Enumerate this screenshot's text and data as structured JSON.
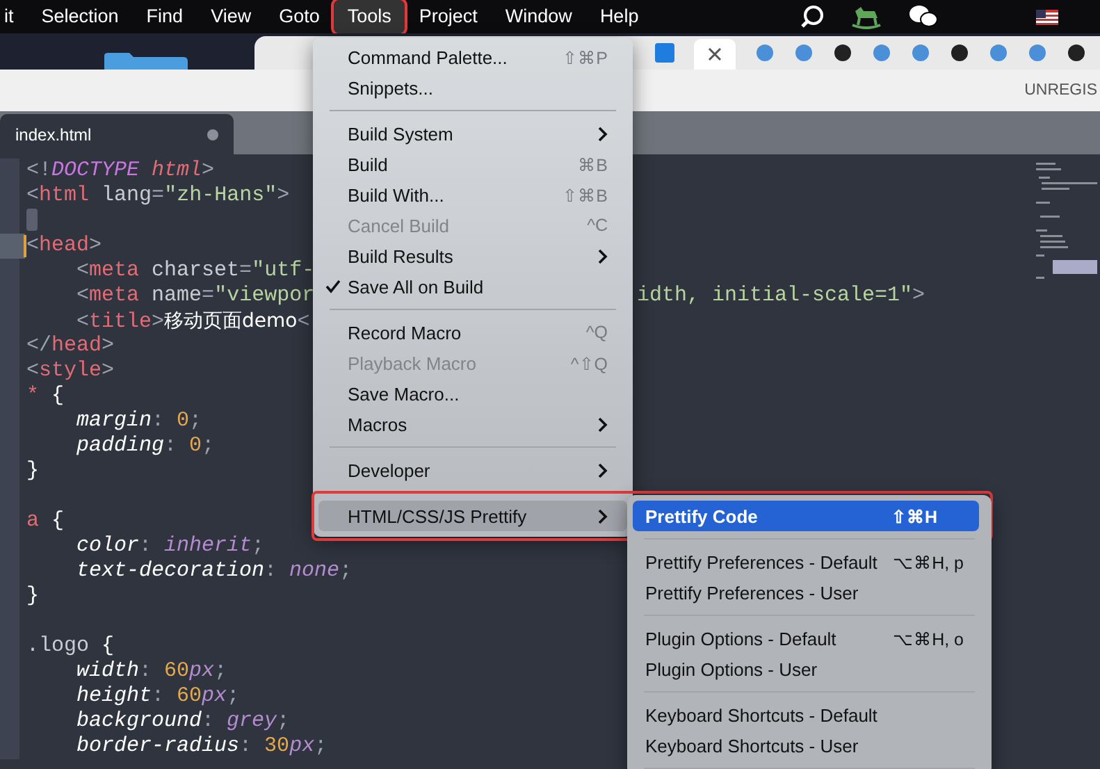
{
  "menu_bar": {
    "items": [
      {
        "label": "it",
        "selected": false
      },
      {
        "label": "Selection",
        "selected": false
      },
      {
        "label": "Find",
        "selected": false
      },
      {
        "label": "View",
        "selected": false
      },
      {
        "label": "Goto",
        "selected": false
      },
      {
        "label": "Tools",
        "selected": true
      },
      {
        "label": "Project",
        "selected": false
      },
      {
        "label": "Window",
        "selected": false
      },
      {
        "label": "Help",
        "selected": false
      }
    ]
  },
  "title_bar": {
    "status": "UNREGIS"
  },
  "tabs": [
    {
      "label": "index.html",
      "selected": true,
      "modified": true
    }
  ],
  "editor": {
    "lines": [
      {
        "current": false,
        "tokens": [
          {
            "text": "<!",
            "kind": "punct"
          },
          {
            "text": "DOCTYPE",
            "kind": "doctype"
          },
          {
            "text": " html",
            "kind": "tagi"
          },
          {
            "text": ">",
            "kind": "punct"
          }
        ]
      },
      {
        "current": false,
        "tokens": [
          {
            "text": "<",
            "kind": "punct"
          },
          {
            "text": "html",
            "kind": "tag"
          },
          {
            "text": " lang",
            "kind": "attr"
          },
          {
            "text": "=",
            "kind": "punct"
          },
          {
            "text": "\"zh-Hans\"",
            "kind": "string"
          },
          {
            "text": ">",
            "kind": "punct"
          }
        ]
      },
      {
        "current": false
      },
      {
        "current": true,
        "tokens": [
          {
            "text": "<",
            "kind": "punct"
          },
          {
            "text": "head",
            "kind": "tag"
          },
          {
            "text": ">",
            "kind": "punct"
          }
        ]
      },
      {
        "current": false,
        "tokens": [
          {
            "text": "    <",
            "kind": "punct"
          },
          {
            "text": "meta",
            "kind": "tag"
          },
          {
            "text": " charset",
            "kind": "attr"
          },
          {
            "text": "=",
            "kind": "punct"
          },
          {
            "text": "\"utf-",
            "kind": "string"
          }
        ]
      },
      {
        "current": false,
        "tokens": [
          {
            "text": "    <",
            "kind": "punct"
          },
          {
            "text": "meta",
            "kind": "tag"
          },
          {
            "text": " name",
            "kind": "attr"
          },
          {
            "text": "=",
            "kind": "punct"
          },
          {
            "text": "\"viewpor",
            "kind": "string"
          }
        ],
        "tail": [
          {
            "text": "idth, initial-scale=1\"",
            "kind": "string"
          },
          {
            "text": ">",
            "kind": "punct"
          }
        ]
      },
      {
        "current": false,
        "tokens": [
          {
            "text": "    <",
            "kind": "punct"
          },
          {
            "text": "title",
            "kind": "tag"
          },
          {
            "text": ">",
            "kind": "punct"
          },
          {
            "text": "移动页面demo",
            "kind": "cjk"
          },
          {
            "text": "<",
            "kind": "punct"
          }
        ]
      },
      {
        "current": false,
        "tokens": [
          {
            "text": "</",
            "kind": "punct"
          },
          {
            "text": "head",
            "kind": "tag"
          },
          {
            "text": ">",
            "kind": "punct"
          }
        ]
      },
      {
        "current": false,
        "tokens": [
          {
            "text": "<",
            "kind": "punct"
          },
          {
            "text": "style",
            "kind": "tag"
          },
          {
            "text": ">",
            "kind": "punct"
          }
        ]
      },
      {
        "current": false,
        "tokens": [
          {
            "text": "*",
            "kind": "selector"
          },
          {
            "text": " {",
            "kind": "brace"
          }
        ]
      },
      {
        "current": false,
        "tokens": [
          {
            "text": "    margin",
            "kind": "prop"
          },
          {
            "text": ":",
            "kind": "punct"
          },
          {
            "text": " 0",
            "kind": "num"
          },
          {
            "text": ";",
            "kind": "punct"
          }
        ]
      },
      {
        "current": false,
        "tokens": [
          {
            "text": "    padding",
            "kind": "prop"
          },
          {
            "text": ":",
            "kind": "punct"
          },
          {
            "text": " 0",
            "kind": "num"
          },
          {
            "text": ";",
            "kind": "punct"
          }
        ]
      },
      {
        "current": false,
        "tokens": [
          {
            "text": "}",
            "kind": "brace"
          }
        ]
      },
      {
        "current": false
      },
      {
        "current": false,
        "tokens": [
          {
            "text": "a",
            "kind": "selector"
          },
          {
            "text": " {",
            "kind": "brace"
          }
        ]
      },
      {
        "current": false,
        "tokens": [
          {
            "text": "    color",
            "kind": "prop"
          },
          {
            "text": ":",
            "kind": "punct"
          },
          {
            "text": " inherit",
            "kind": "value"
          },
          {
            "text": ";",
            "kind": "punct"
          }
        ]
      },
      {
        "current": false,
        "tokens": [
          {
            "text": "    text-decoration",
            "kind": "prop"
          },
          {
            "text": ":",
            "kind": "punct"
          },
          {
            "text": " none",
            "kind": "value"
          },
          {
            "text": ";",
            "kind": "punct"
          }
        ]
      },
      {
        "current": false,
        "tokens": [
          {
            "text": "}",
            "kind": "brace"
          }
        ]
      },
      {
        "current": false
      },
      {
        "current": false,
        "tokens": [
          {
            "text": ".logo",
            "kind": "class"
          },
          {
            "text": " {",
            "kind": "brace"
          }
        ]
      },
      {
        "current": false,
        "tokens": [
          {
            "text": "    width",
            "kind": "prop"
          },
          {
            "text": ":",
            "kind": "punct"
          },
          {
            "text": " 60",
            "kind": "num"
          },
          {
            "text": "px",
            "kind": "unit"
          },
          {
            "text": ";",
            "kind": "punct"
          }
        ]
      },
      {
        "current": false,
        "tokens": [
          {
            "text": "    height",
            "kind": "prop"
          },
          {
            "text": ":",
            "kind": "punct"
          },
          {
            "text": " 60",
            "kind": "num"
          },
          {
            "text": "px",
            "kind": "unit"
          },
          {
            "text": ";",
            "kind": "punct"
          }
        ]
      },
      {
        "current": false,
        "tokens": [
          {
            "text": "    background",
            "kind": "prop"
          },
          {
            "text": ":",
            "kind": "punct"
          },
          {
            "text": " grey",
            "kind": "value"
          },
          {
            "text": ";",
            "kind": "punct"
          }
        ]
      },
      {
        "current": false,
        "tokens": [
          {
            "text": "    border-radius",
            "kind": "prop"
          },
          {
            "text": ":",
            "kind": "punct"
          },
          {
            "text": " 30",
            "kind": "num"
          },
          {
            "text": "px",
            "kind": "unit"
          },
          {
            "text": ";",
            "kind": "punct"
          }
        ]
      }
    ]
  },
  "tools_menu": {
    "items": [
      {
        "kind": "item",
        "label": "Command Palette...",
        "shortcut": "⇧⌘P",
        "submenu": false,
        "disabled": false,
        "checked": false,
        "selected": false,
        "outlined": false
      },
      {
        "kind": "item",
        "label": "Snippets...",
        "submenu": false,
        "disabled": false,
        "checked": false,
        "selected": false,
        "outlined": false
      },
      {
        "kind": "separator"
      },
      {
        "kind": "item",
        "label": "Build System",
        "submenu": true,
        "disabled": false,
        "checked": false,
        "selected": false,
        "outlined": false
      },
      {
        "kind": "item",
        "label": "Build",
        "shortcut": "⌘B",
        "submenu": false,
        "disabled": false,
        "checked": false,
        "selected": false,
        "outlined": false
      },
      {
        "kind": "item",
        "label": "Build With...",
        "shortcut": "⇧⌘B",
        "submenu": false,
        "disabled": false,
        "checked": false,
        "selected": false,
        "outlined": false
      },
      {
        "kind": "item",
        "label": "Cancel Build",
        "shortcut": "^C",
        "submenu": false,
        "disabled": true,
        "checked": false,
        "selected": false,
        "outlined": false
      },
      {
        "kind": "item",
        "label": "Build Results",
        "submenu": true,
        "disabled": false,
        "checked": false,
        "selected": false,
        "outlined": false
      },
      {
        "kind": "item",
        "label": "Save All on Build",
        "submenu": false,
        "disabled": false,
        "checked": true,
        "selected": false,
        "outlined": false
      },
      {
        "kind": "separator"
      },
      {
        "kind": "item",
        "label": "Record Macro",
        "shortcut": "^Q",
        "submenu": false,
        "disabled": false,
        "checked": false,
        "selected": false,
        "outlined": false
      },
      {
        "kind": "item",
        "label": "Playback Macro",
        "shortcut": "^⇧Q",
        "submenu": false,
        "disabled": true,
        "checked": false,
        "selected": false,
        "outlined": false
      },
      {
        "kind": "item",
        "label": "Save Macro...",
        "submenu": false,
        "disabled": false,
        "checked": false,
        "selected": false,
        "outlined": false
      },
      {
        "kind": "item",
        "label": "Macros",
        "submenu": true,
        "disabled": false,
        "checked": false,
        "selected": false,
        "outlined": false
      },
      {
        "kind": "separator"
      },
      {
        "kind": "item",
        "label": "Developer",
        "submenu": true,
        "disabled": false,
        "checked": false,
        "selected": false,
        "outlined": false
      },
      {
        "kind": "separator"
      },
      {
        "kind": "item",
        "label": "HTML/CSS/JS Prettify",
        "submenu": true,
        "disabled": false,
        "checked": false,
        "selected": true,
        "outlined": true
      }
    ]
  },
  "prettify_submenu": {
    "items": [
      {
        "kind": "item",
        "label": "Prettify Code",
        "shortcut": "⇧⌘H",
        "selected": true
      },
      {
        "kind": "separator"
      },
      {
        "kind": "item",
        "label": "Prettify Preferences - Default",
        "shortcut": "⌥⌘H, p",
        "selected": false
      },
      {
        "kind": "item",
        "label": "Prettify Preferences - User",
        "selected": false
      },
      {
        "kind": "separator"
      },
      {
        "kind": "item",
        "label": "Plugin Options - Default",
        "shortcut": "⌥⌘H, o",
        "selected": false
      },
      {
        "kind": "item",
        "label": "Plugin Options - User",
        "selected": false
      },
      {
        "kind": "separator"
      },
      {
        "kind": "item",
        "label": "Keyboard Shortcuts - Default",
        "selected": false
      },
      {
        "kind": "item",
        "label": "Keyboard Shortcuts - User",
        "selected": false
      },
      {
        "kind": "separator"
      }
    ]
  }
}
